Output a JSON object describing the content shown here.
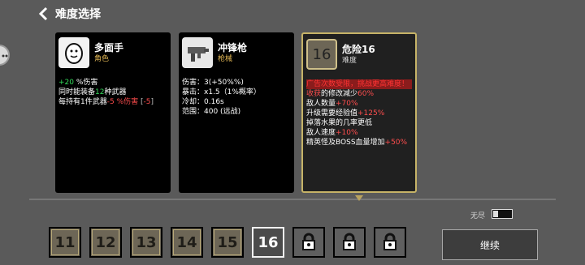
{
  "header": {
    "title": "难度选择"
  },
  "cards": {
    "character": {
      "name": "多面手",
      "type": "角色",
      "line1_value": "+20",
      "line1_unit": " %伤害",
      "line2_pre": "同时能装备",
      "line2_value": "12",
      "line2_post": "种武器",
      "line3_pre": "每持有1件武器",
      "line3_value": "-5",
      "line3_mid": " %伤害",
      "line3_suffix_left": " [",
      "line3_suffix_value": "-5",
      "line3_suffix_right": "]"
    },
    "weapon": {
      "name": "冲锋枪",
      "type": "枪械",
      "damage_label": "伤害：",
      "damage_value": "3(+50%",
      "damage_icon": "%",
      "damage_close": ")",
      "crit_label": "暴击：",
      "crit_value": "x1.5（1%概率）",
      "cooldown_label": "冷却：",
      "cooldown_value": "0.16s",
      "range_label": "范围：",
      "range_value": "400 (远战)"
    },
    "difficulty": {
      "level": "16",
      "name": "危险16",
      "type": "难度",
      "warning": "广告次数受限，挑战更高难度！",
      "harvest_a": "收获",
      "harvest_b": "的修改减少",
      "harvest_value": "60%",
      "enemy_count_label": "敌人数量",
      "enemy_count_value": "+70%",
      "upgrade_label": "升级需要经验值",
      "upgrade_value": "+125%",
      "fruit_text": "掉落水果的几率更低",
      "speed_label": "敌人速度",
      "speed_value": "+10%",
      "elite_label": "精英怪及BOSS血量增加",
      "elite_value": "+50%"
    }
  },
  "toggle": {
    "label": "无尽"
  },
  "levels": [
    {
      "label": "11"
    },
    {
      "label": "12"
    },
    {
      "label": "13"
    },
    {
      "label": "14"
    },
    {
      "label": "15"
    },
    {
      "label": "16"
    }
  ],
  "continue_label": "继续",
  "icons": [
    "back-icon",
    "egg-icon",
    "gun-icon",
    "lock-icon",
    "edge-menu-icon"
  ],
  "colors": {
    "selected": "#c6b367",
    "positive": "#34d85b",
    "negative": "#ff4d4d"
  }
}
